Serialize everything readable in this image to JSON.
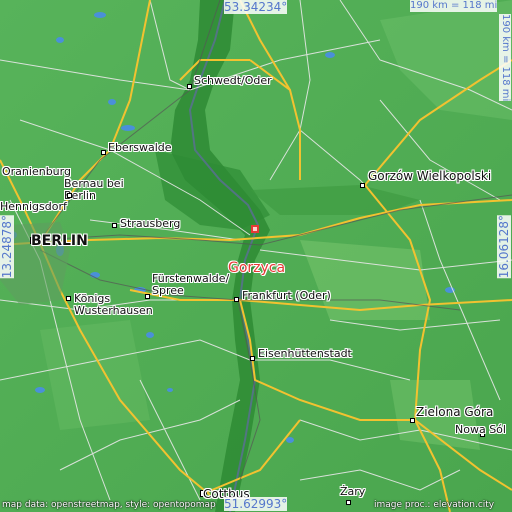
{
  "map": {
    "target": {
      "name": "Gorzyca",
      "color": "#e53935"
    },
    "places": [
      {
        "id": "schwedt",
        "name": "Schwedt/Oder"
      },
      {
        "id": "eberswalde",
        "name": "Eberswalde"
      },
      {
        "id": "oranienburg",
        "name": "Oranienburg"
      },
      {
        "id": "bernau",
        "name": "Bernau bei\nBerlin"
      },
      {
        "id": "hennigsdorf",
        "name": "Hennigsdorf"
      },
      {
        "id": "berlin",
        "name": "BERLIN"
      },
      {
        "id": "strausberg",
        "name": "Strausberg"
      },
      {
        "id": "gorzow",
        "name": "Gorzów Wielkopolski"
      },
      {
        "id": "fuerstenwalde",
        "name": "Fürstenwalde/\nSpree"
      },
      {
        "id": "frankfurt",
        "name": "Frankfurt (Oder)"
      },
      {
        "id": "koenigs",
        "name": "Königs\nWusterhausen"
      },
      {
        "id": "eisenhuettenstadt",
        "name": "Eisenhüttenstadt"
      },
      {
        "id": "zielona",
        "name": "Zielona Góra"
      },
      {
        "id": "nowasol",
        "name": "Nowa Sól"
      },
      {
        "id": "cottbus",
        "name": "Cottbus"
      },
      {
        "id": "zary",
        "name": "Żary"
      }
    ],
    "coordinates": {
      "north": "53.34234°",
      "south": "51.62993°",
      "west": "13.24878°",
      "east": "16.06128°"
    },
    "scale": {
      "horizontal": "190 km = 118 mi",
      "vertical": "190 km = 118 mi"
    },
    "credits": {
      "left": "map data: openstreetmap, style: opentopomap",
      "right": "image proc.: elevation.city"
    },
    "colors": {
      "land": "#4caf50",
      "lowland": "#2e7d32",
      "water": "#4a90d9",
      "roads": "#f2c230",
      "minor_roads": "#e8e8e8"
    }
  }
}
